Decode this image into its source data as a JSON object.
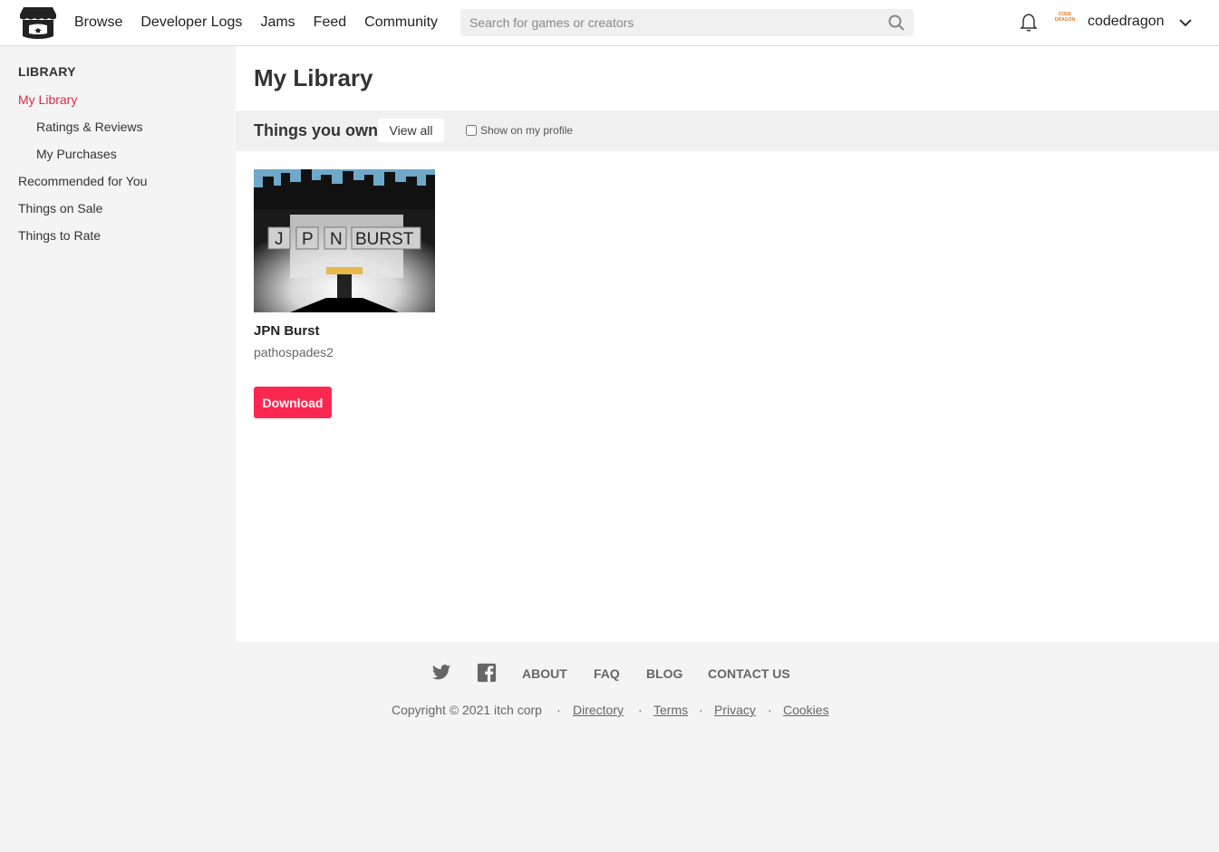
{
  "header": {
    "nav": [
      "Browse",
      "Developer Logs",
      "Jams",
      "Feed",
      "Community"
    ],
    "search_placeholder": "Search for games or creators",
    "avatar_text": "CODE DRAGON",
    "username": "codedragon"
  },
  "sidebar": {
    "title": "LIBRARY",
    "items": [
      {
        "label": "My Library",
        "active": true
      },
      {
        "label": "Ratings & Reviews",
        "sub": true
      },
      {
        "label": "My Purchases",
        "sub": true
      },
      {
        "label": "Recommended for You"
      },
      {
        "label": "Things on Sale"
      },
      {
        "label": "Things to Rate"
      }
    ]
  },
  "main": {
    "title": "My Library",
    "section_title": "Things you own",
    "view_all": "View all",
    "show_on_profile": "Show on my profile",
    "game": {
      "title": "JPN Burst",
      "author": "pathospades2",
      "cover_text": [
        "J",
        "P",
        "N",
        "BURST"
      ],
      "download": "Download"
    }
  },
  "footer": {
    "links": [
      "ABOUT",
      "FAQ",
      "BLOG",
      "CONTACT US"
    ],
    "copyright": "Copyright © 2021 itch corp",
    "legal": [
      "Directory",
      "Terms",
      "Privacy",
      "Cookies"
    ],
    "separator": "·"
  },
  "colors": {
    "accent": "#fa2851",
    "active_link": "#da2c47"
  }
}
